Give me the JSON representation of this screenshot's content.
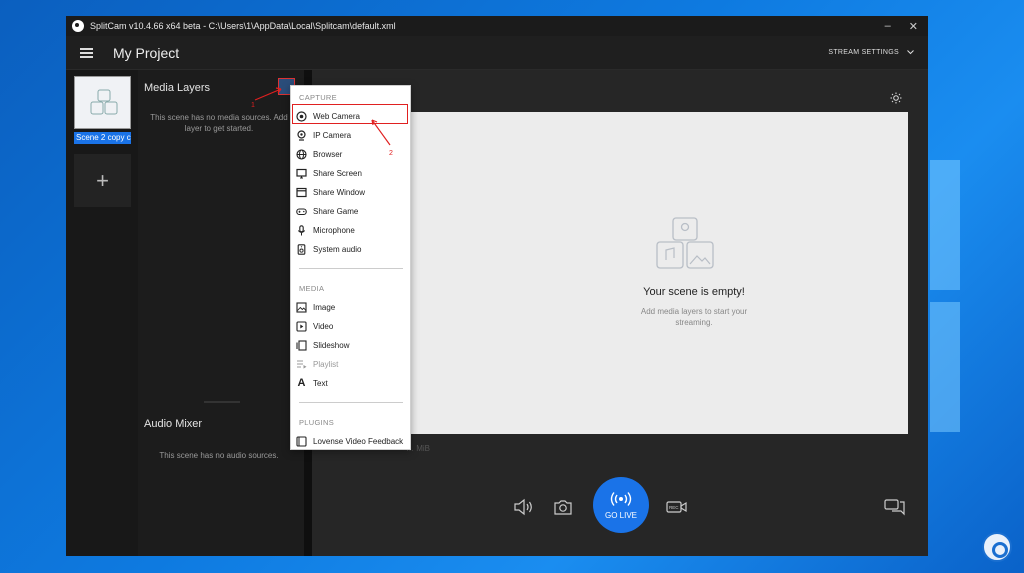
{
  "window": {
    "title": "SplitCam v10.4.66 x64 beta - C:\\Users\\1\\AppData\\Local\\Splitcam\\default.xml",
    "controls": [
      "–",
      "✕"
    ]
  },
  "header": {
    "project_title": "My Project",
    "stream_settings": "STREAM SETTINGS"
  },
  "scenes": {
    "items": [
      {
        "label": "Scene 2 copy c"
      }
    ],
    "add_symbol": "+"
  },
  "layers": {
    "title": "Media Layers",
    "empty_message": "This scene has no media sources. Add layer to get started."
  },
  "audio": {
    "title": "Audio Mixer",
    "empty_message": "This scene has no audio sources."
  },
  "preview": {
    "empty_title": "Your scene is empty!",
    "empty_subtitle": "Add media layers to start your streaming.",
    "footer_text": "… MiB"
  },
  "controls": {
    "go_live_label": "GO LIVE"
  },
  "menu": {
    "sections": [
      {
        "title": "CAPTURE",
        "items": [
          {
            "label": "Web Camera",
            "icon": "webcam-icon"
          },
          {
            "label": "IP Camera",
            "icon": "ip-camera-icon"
          },
          {
            "label": "Browser",
            "icon": "globe-icon"
          },
          {
            "label": "Share Screen",
            "icon": "monitor-icon"
          },
          {
            "label": "Share Window",
            "icon": "window-icon"
          },
          {
            "label": "Share Game",
            "icon": "gamepad-icon"
          },
          {
            "label": "Microphone",
            "icon": "microphone-icon"
          },
          {
            "label": "System audio",
            "icon": "speaker-icon"
          }
        ]
      },
      {
        "title": "MEDIA",
        "items": [
          {
            "label": "Image",
            "icon": "image-icon"
          },
          {
            "label": "Video",
            "icon": "video-icon"
          },
          {
            "label": "Slideshow",
            "icon": "slideshow-icon"
          },
          {
            "label": "Playlist",
            "icon": "playlist-icon",
            "disabled": true
          },
          {
            "label": "Text",
            "icon": "text-icon"
          }
        ]
      },
      {
        "title": "PLUGINS",
        "items": [
          {
            "label": "Lovense Video Feedback",
            "icon": "plugin-icon"
          }
        ]
      }
    ]
  },
  "annotations": {
    "step1": "1",
    "step2": "2"
  },
  "colors": {
    "accent": "#1a73e8",
    "annotation": "#e02020",
    "background": "#1f1f1f"
  }
}
